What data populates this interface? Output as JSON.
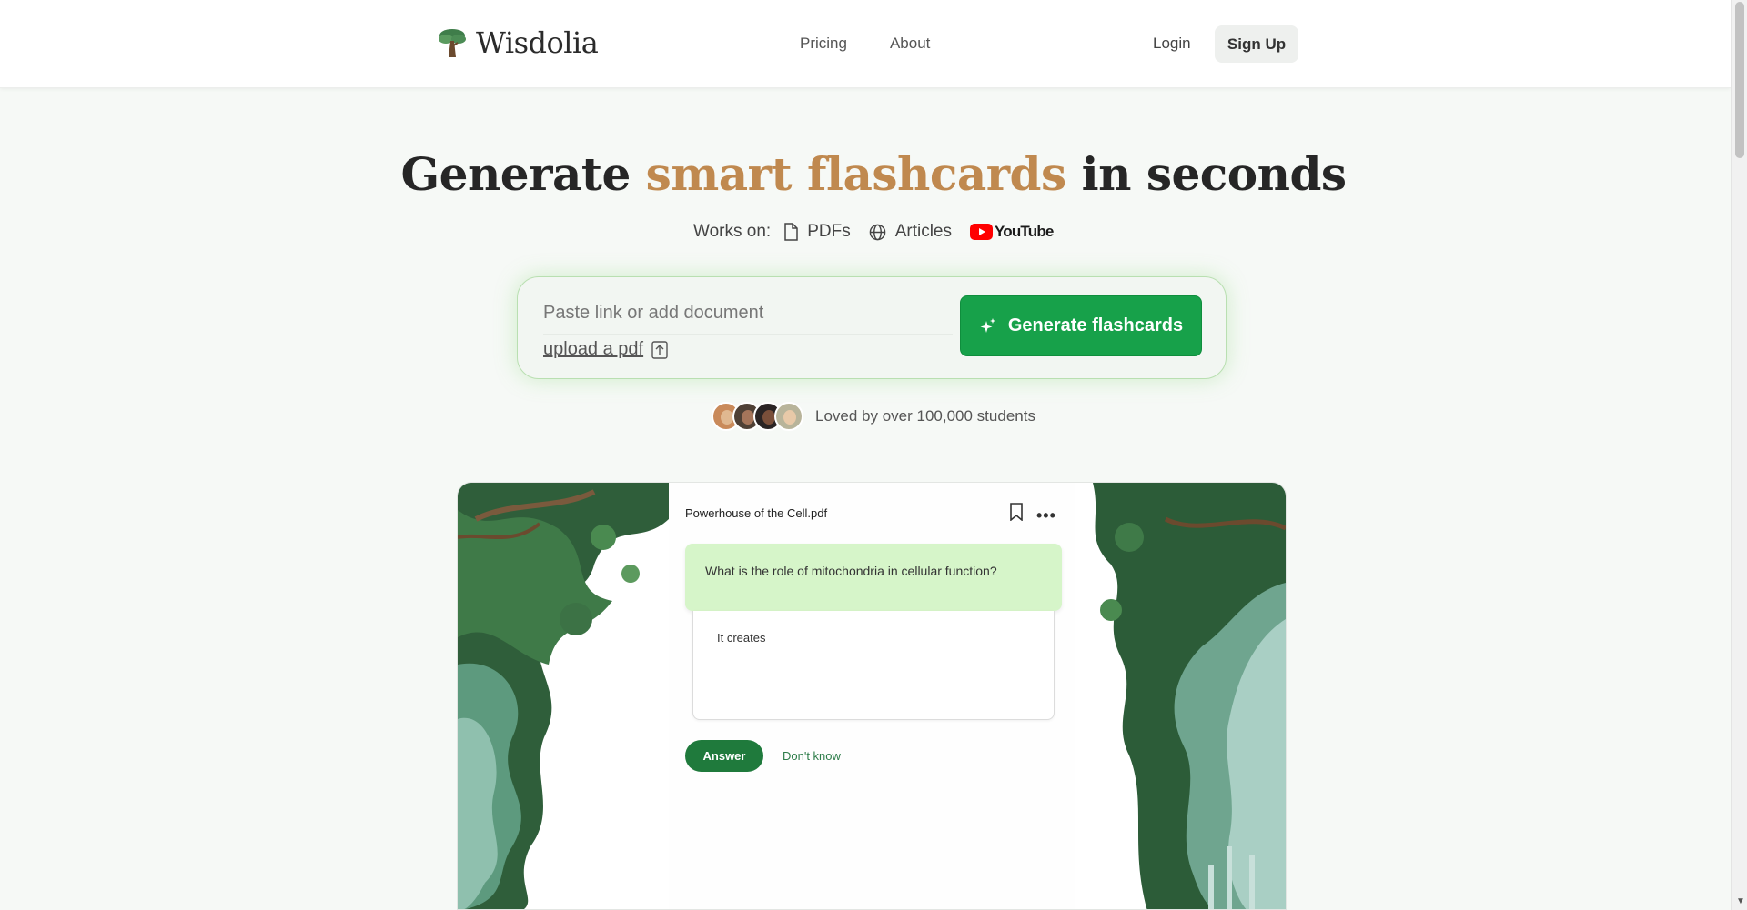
{
  "header": {
    "brand": "Wisdolia",
    "nav": [
      "Pricing",
      "About"
    ],
    "login": "Login",
    "signup": "Sign Up"
  },
  "hero": {
    "headline_start": "Generate ",
    "headline_accent": "smart flashcards",
    "headline_end": " in seconds",
    "works_label": "Works on:",
    "sources": [
      "PDFs",
      "Articles"
    ],
    "youtube": "YouTube",
    "input_placeholder": "Paste link or add document",
    "upload_label": "upload a pdf",
    "generate_button": "Generate flashcards",
    "loved_text": "Loved by over 100,000 students"
  },
  "demo": {
    "file_name": "Powerhouse of the Cell.pdf",
    "question": "What is the role of mitochondria in cellular function?",
    "answer_text": "It creates",
    "answer_button": "Answer",
    "dont_know": "Don't know"
  },
  "colors": {
    "accent": "#c0894f",
    "primary_green": "#17a14a",
    "question_bg": "#d6f5c9",
    "answer_button": "#1f7a3c"
  },
  "icons": {
    "logo": "tree-icon",
    "pdf": "document-icon",
    "articles": "globe-icon",
    "youtube": "youtube-logo",
    "upload": "upload-icon",
    "generate": "sparkles-icon",
    "bookmark": "bookmark-icon",
    "more": "more-horizontal-icon"
  }
}
